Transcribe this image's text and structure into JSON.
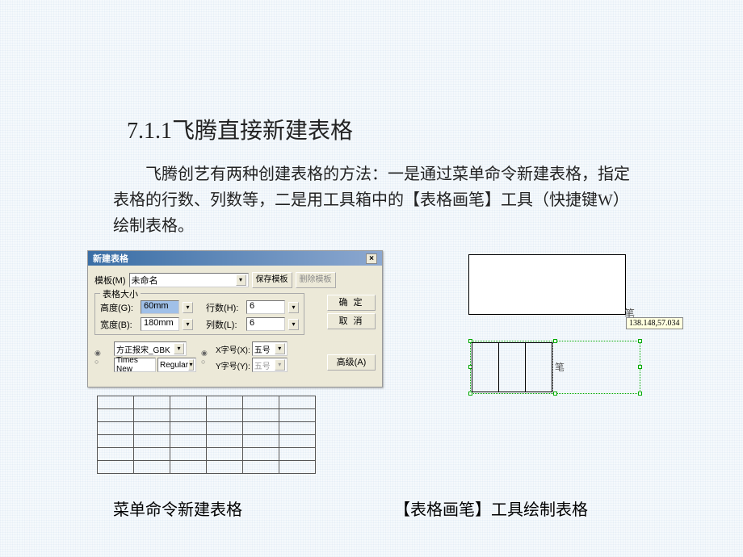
{
  "heading": "7.1.1飞腾直接新建表格",
  "body": "飞腾创艺有两种创建表格的方法：一是通过菜单命令新建表格，指定表格的行数、列数等，二是用工具箱中的【表格画笔】工具（快捷键W） 绘制表格。",
  "dialog": {
    "title": "新建表格",
    "template_label": "模板(M)",
    "template_value": "未命名",
    "save_tpl_btn": "保存模板",
    "del_tpl_btn": "删除模板",
    "ok_btn": "确  定",
    "cancel_btn": "取  消",
    "advanced_btn": "高级(A)",
    "size_group": "表格大小",
    "height_label": "高度(G):",
    "height_value": "60mm",
    "width_label": "宽度(B):",
    "width_value": "180mm",
    "rows_label": "行数(H):",
    "rows_value": "6",
    "cols_label": "列数(L):",
    "cols_value": "6",
    "font_cn": "方正报宋_GBK",
    "font_en": "Times New",
    "font_style": "Regular",
    "x_size_label": "X字号(X):",
    "x_size_value": "五号",
    "y_size_label": "Y字号(Y):",
    "y_size_value": "五号"
  },
  "right": {
    "pen_label": "笔",
    "tooltip": "138.148,57.034",
    "pen_label2": "笔"
  },
  "captions": {
    "left": "菜单命令新建表格",
    "right": "【表格画笔】工具绘制表格"
  }
}
